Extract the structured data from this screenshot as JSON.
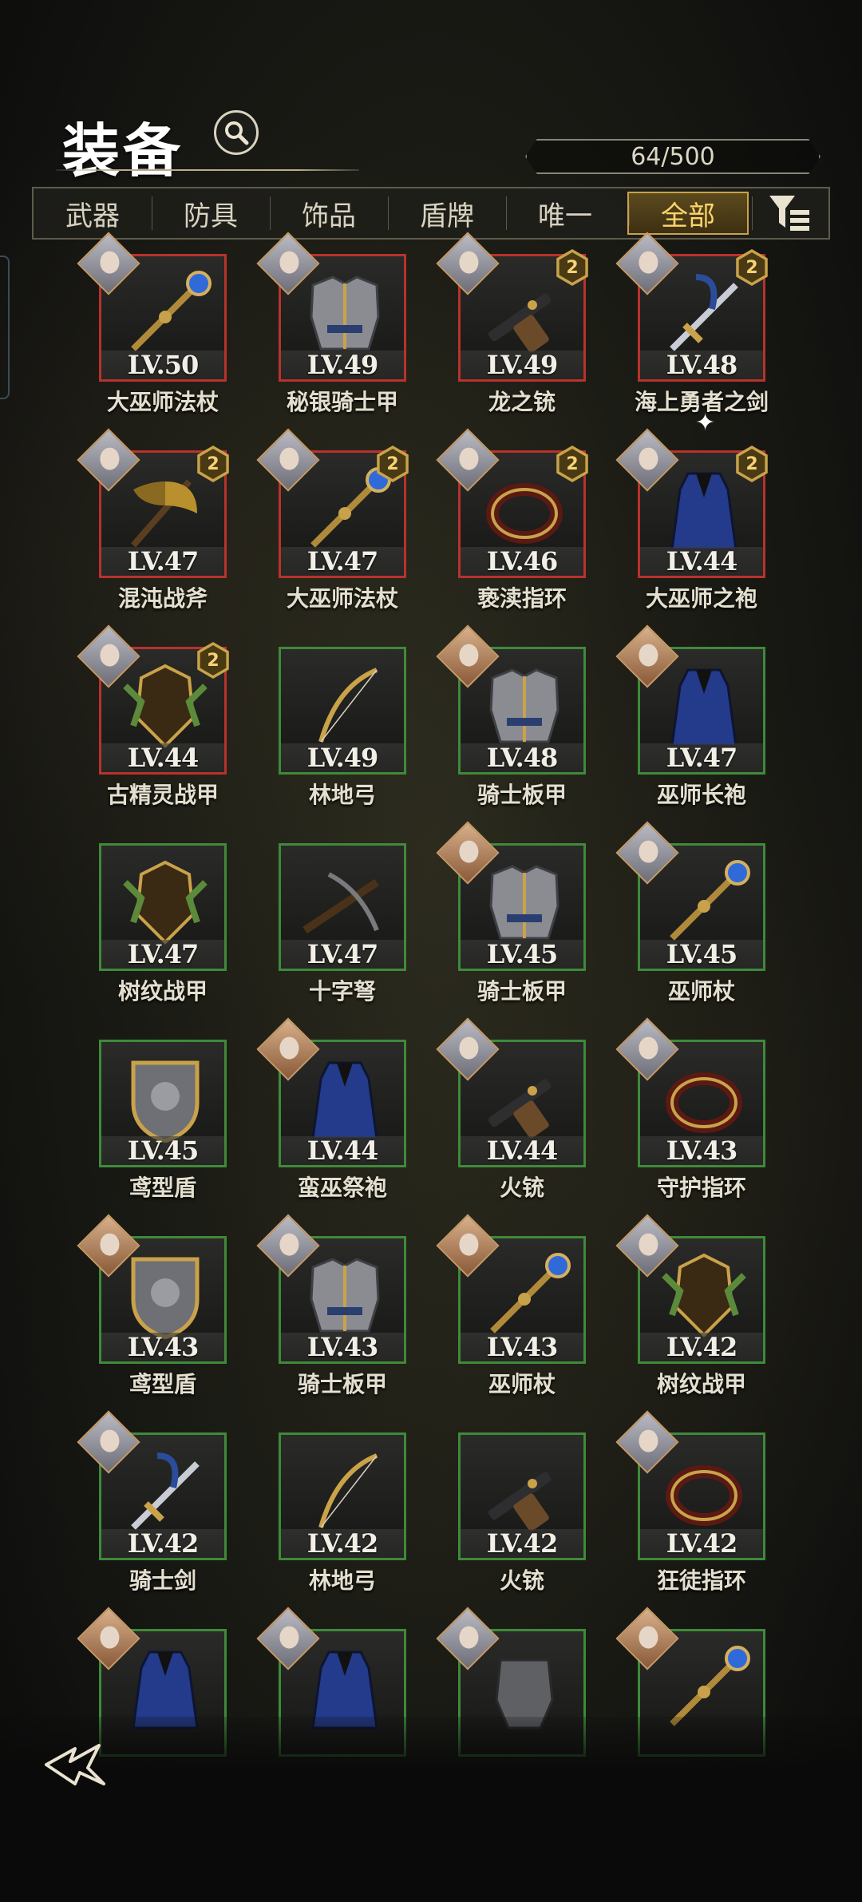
{
  "header": {
    "title": "装备",
    "count": "64/500"
  },
  "tabs": [
    {
      "label": "武器",
      "active": false
    },
    {
      "label": "防具",
      "active": false
    },
    {
      "label": "饰品",
      "active": false
    },
    {
      "label": "盾牌",
      "active": false
    },
    {
      "label": "唯一",
      "active": false
    },
    {
      "label": "全部",
      "active": true
    }
  ],
  "items": [
    {
      "level": "LV.50",
      "name": "大巫师法杖",
      "rarity": "red",
      "rank": "",
      "portrait": "cool",
      "icon": "staff-icon"
    },
    {
      "level": "LV.49",
      "name": "秘银骑士甲",
      "rarity": "red",
      "rank": "",
      "portrait": "cool",
      "icon": "armor-icon"
    },
    {
      "level": "LV.49",
      "name": "龙之铳",
      "rarity": "red",
      "rank": "2",
      "portrait": "cool",
      "icon": "gun-icon"
    },
    {
      "level": "LV.48",
      "name": "海上勇者之剑",
      "rarity": "red",
      "rank": "2",
      "portrait": "cool",
      "icon": "sword-icon"
    },
    {
      "level": "LV.47",
      "name": "混沌战斧",
      "rarity": "red",
      "rank": "2",
      "portrait": "cool",
      "icon": "axe-icon"
    },
    {
      "level": "LV.47",
      "name": "大巫师法杖",
      "rarity": "red",
      "rank": "2",
      "portrait": "cool",
      "icon": "staff-icon"
    },
    {
      "level": "LV.46",
      "name": "亵渎指环",
      "rarity": "red",
      "rank": "2",
      "portrait": "cool",
      "icon": "ring-icon"
    },
    {
      "level": "LV.44",
      "name": "大巫师之袍",
      "rarity": "red",
      "rank": "2",
      "portrait": "cool",
      "icon": "robe-icon"
    },
    {
      "level": "LV.44",
      "name": "古精灵战甲",
      "rarity": "red",
      "rank": "2",
      "portrait": "cool",
      "icon": "elven-armor-icon"
    },
    {
      "level": "LV.49",
      "name": "林地弓",
      "rarity": "green",
      "rank": "",
      "portrait": "",
      "icon": "bow-icon"
    },
    {
      "level": "LV.48",
      "name": "骑士板甲",
      "rarity": "green",
      "rank": "",
      "portrait": "warm",
      "icon": "armor-icon"
    },
    {
      "level": "LV.47",
      "name": "巫师长袍",
      "rarity": "green",
      "rank": "",
      "portrait": "warm",
      "icon": "robe-icon"
    },
    {
      "level": "LV.47",
      "name": "树纹战甲",
      "rarity": "green",
      "rank": "",
      "portrait": "",
      "icon": "elven-armor-icon"
    },
    {
      "level": "LV.47",
      "name": "十字弩",
      "rarity": "green",
      "rank": "",
      "portrait": "",
      "icon": "crossbow-icon"
    },
    {
      "level": "LV.45",
      "name": "骑士板甲",
      "rarity": "green",
      "rank": "",
      "portrait": "warm",
      "icon": "armor-icon"
    },
    {
      "level": "LV.45",
      "name": "巫师杖",
      "rarity": "green",
      "rank": "",
      "portrait": "cool",
      "icon": "staff-icon"
    },
    {
      "level": "LV.45",
      "name": "鸢型盾",
      "rarity": "green",
      "rank": "",
      "portrait": "",
      "icon": "shield-icon"
    },
    {
      "level": "LV.44",
      "name": "蛮巫祭袍",
      "rarity": "green",
      "rank": "",
      "portrait": "warm",
      "icon": "robe-icon"
    },
    {
      "level": "LV.44",
      "name": "火铳",
      "rarity": "green",
      "rank": "",
      "portrait": "cool",
      "icon": "gun-icon"
    },
    {
      "level": "LV.43",
      "name": "守护指环",
      "rarity": "green",
      "rank": "",
      "portrait": "cool",
      "icon": "ring-icon"
    },
    {
      "level": "LV.43",
      "name": "鸢型盾",
      "rarity": "green",
      "rank": "",
      "portrait": "warm",
      "icon": "shield-icon"
    },
    {
      "level": "LV.43",
      "name": "骑士板甲",
      "rarity": "green",
      "rank": "",
      "portrait": "cool",
      "icon": "armor-icon"
    },
    {
      "level": "LV.43",
      "name": "巫师杖",
      "rarity": "green",
      "rank": "",
      "portrait": "warm",
      "icon": "staff-icon"
    },
    {
      "level": "LV.42",
      "name": "树纹战甲",
      "rarity": "green",
      "rank": "",
      "portrait": "cool",
      "icon": "elven-armor-icon"
    },
    {
      "level": "LV.42",
      "name": "骑士剑",
      "rarity": "green",
      "rank": "",
      "portrait": "cool",
      "icon": "sword-icon"
    },
    {
      "level": "LV.42",
      "name": "林地弓",
      "rarity": "green",
      "rank": "",
      "portrait": "",
      "icon": "bow-icon"
    },
    {
      "level": "LV.42",
      "name": "火铳",
      "rarity": "green",
      "rank": "",
      "portrait": "",
      "icon": "gun-icon"
    },
    {
      "level": "LV.42",
      "name": "狂徒指环",
      "rarity": "green",
      "rank": "",
      "portrait": "cool",
      "icon": "ring-icon"
    },
    {
      "level": "",
      "name": "",
      "rarity": "green",
      "rank": "",
      "portrait": "warm",
      "icon": "robe-icon"
    },
    {
      "level": "",
      "name": "",
      "rarity": "green",
      "rank": "",
      "portrait": "cool",
      "icon": "robe-icon"
    },
    {
      "level": "",
      "name": "",
      "rarity": "green",
      "rank": "",
      "portrait": "cool",
      "icon": "gauntlet-icon"
    },
    {
      "level": "",
      "name": "",
      "rarity": "green",
      "rank": "",
      "portrait": "warm",
      "icon": "staff-icon"
    }
  ],
  "colors": {
    "rarity_red": "#b8322c",
    "rarity_green": "#3e8a3a",
    "active_tab": "#c9a24a",
    "rank_gold": "#c9a34a"
  }
}
